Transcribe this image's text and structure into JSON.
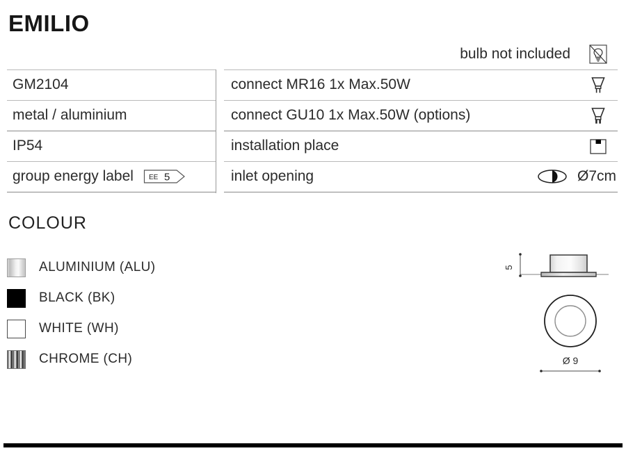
{
  "product": {
    "title": "EMILIO"
  },
  "header_note": {
    "text": "bulb not included",
    "icon": "bulb-crossed-out-icon"
  },
  "spec_table": {
    "rows": [
      {
        "left_label": "GM2104",
        "right_label": "connect MR16 1x Max.50W",
        "right_icon": "mr16-lamp-icon"
      },
      {
        "left_label": "metal / aluminium",
        "right_label": "connect GU10 1x Max.50W (options)",
        "right_icon": "gu10-lamp-icon"
      },
      {
        "left_label": "IP54",
        "right_label": "installation place",
        "right_icon": "ceiling-mount-icon"
      },
      {
        "left_label": "group energy label",
        "left_badge": {
          "prefix": "EE",
          "value": "5"
        },
        "right_label": "inlet opening",
        "right_icon": "inlet-opening-icon",
        "right_value": "Ø7cm"
      }
    ]
  },
  "colour": {
    "heading": "COLOUR",
    "items": [
      {
        "label": "ALUMINIUM (ALU)",
        "swatch": "aluminium-swatch",
        "hex": "#d8d8d8"
      },
      {
        "label": "BLACK (BK)",
        "swatch": "black-swatch",
        "hex": "#000000"
      },
      {
        "label": "WHITE (WH)",
        "swatch": "white-swatch",
        "hex": "#ffffff"
      },
      {
        "label": "CHROME (CH)",
        "swatch": "chrome-swatch",
        "hex": "#9a9a9a"
      }
    ]
  },
  "technical_drawing": {
    "height_dimension": "5",
    "diameter_dimension": "Ø 9"
  }
}
